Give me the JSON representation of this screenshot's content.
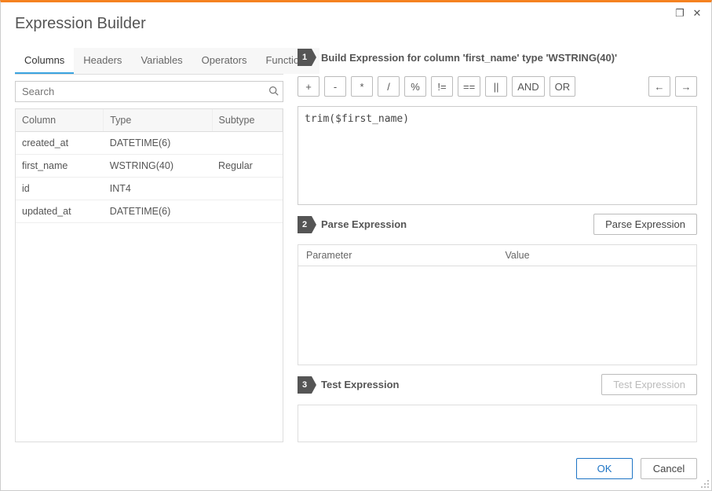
{
  "title": "Expression Builder",
  "windowControls": {
    "maximize": "❐",
    "close": "✕"
  },
  "tabs": [
    "Columns",
    "Headers",
    "Variables",
    "Operators",
    "Functions"
  ],
  "activeTabIndex": 0,
  "search": {
    "placeholder": "Search"
  },
  "columnsTable": {
    "headers": [
      "Column",
      "Type",
      "Subtype"
    ],
    "rows": [
      {
        "col": "created_at",
        "type": "DATETIME(6)",
        "sub": ""
      },
      {
        "col": "first_name",
        "type": "WSTRING(40)",
        "sub": "Regular"
      },
      {
        "col": "id",
        "type": "INT4",
        "sub": ""
      },
      {
        "col": "updated_at",
        "type": "DATETIME(6)",
        "sub": ""
      }
    ]
  },
  "build": {
    "step": "1",
    "title": "Build Expression for column 'first_name' type 'WSTRING(40)'",
    "ops": [
      "+",
      "-",
      "*",
      "/",
      "%",
      "!=",
      "==",
      "||",
      "AND",
      "OR"
    ],
    "undo": "←",
    "redo": "→",
    "expression": "trim($first_name)"
  },
  "parse": {
    "step": "2",
    "title": "Parse Expression",
    "button": "Parse Expression",
    "headers": [
      "Parameter",
      "Value"
    ]
  },
  "test": {
    "step": "3",
    "title": "Test Expression",
    "button": "Test Expression"
  },
  "footer": {
    "ok": "OK",
    "cancel": "Cancel"
  }
}
